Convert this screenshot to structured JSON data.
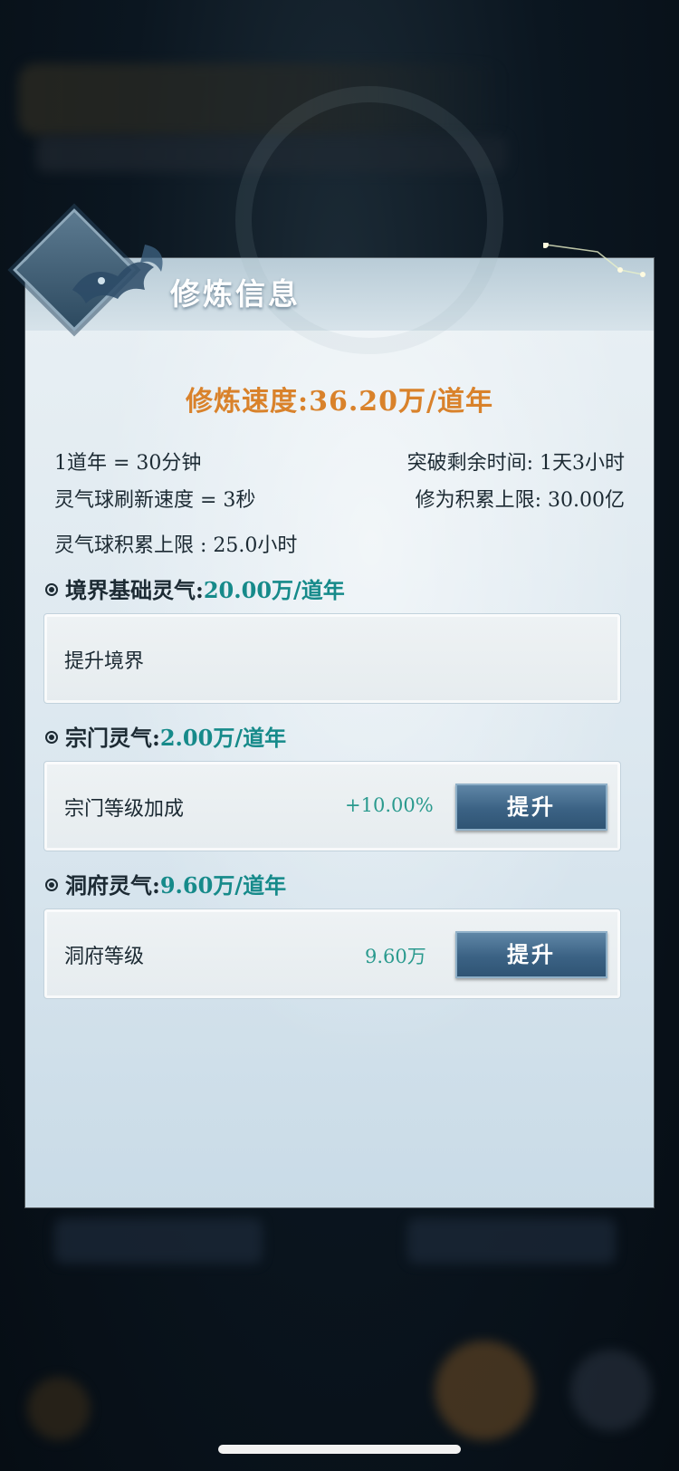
{
  "panel": {
    "title": "修炼信息",
    "speed": "修炼速度:36.20万/道年"
  },
  "stats": {
    "dao_year": "1道年 = 30分钟",
    "breakthrough": "突破剩余时间: 1天3小时",
    "orb_refresh": "灵气球刷新速度 = 3秒",
    "cultivation_cap": "修为积累上限: 30.00亿",
    "orb_cap": "灵气球积累上限 : 25.0小时"
  },
  "sections": [
    {
      "label": "境界基础灵气:",
      "value": "20.00万/道年",
      "row_label": "提升境界"
    },
    {
      "label": "宗门灵气:",
      "value": "2.00万/道年",
      "row_label": "宗门等级加成",
      "row_value": "+10.00%",
      "button": "提升"
    },
    {
      "label": "洞府灵气:",
      "value": "9.60万/道年",
      "row_label": "洞府等级",
      "row_value": "9.60万",
      "button": "提升"
    }
  ],
  "colors": {
    "accent_orange": "#d9822b",
    "accent_teal": "#168a8a",
    "button_blue": "#3b6284"
  }
}
